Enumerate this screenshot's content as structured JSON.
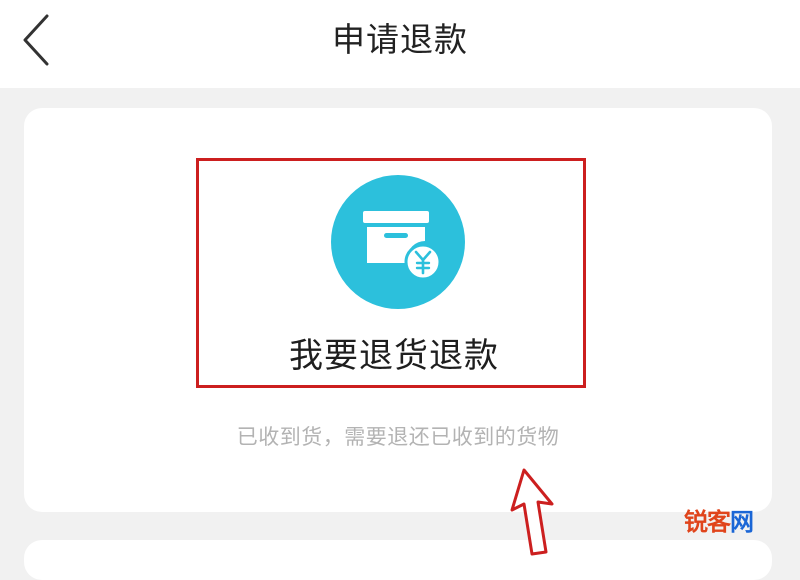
{
  "header": {
    "title": "申请退款",
    "back_icon": "chevron-left-icon"
  },
  "refund_option": {
    "label": "我要退货退款",
    "description": "已收到货，需要退还已收到的货物",
    "icon": "box-yuan-icon",
    "icon_bg_color": "#2cc0dc",
    "highlight_color": "#cc1f1f"
  },
  "watermark": {
    "text_part1": "锐客",
    "text_part2": "网"
  },
  "colors": {
    "page_bg": "#f1f1f1",
    "card_bg": "#ffffff",
    "title_text": "#222222",
    "desc_text": "#b3b3b3",
    "arrow": "#cc1f1f"
  }
}
